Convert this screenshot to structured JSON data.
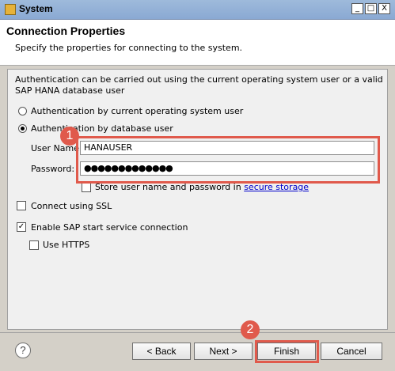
{
  "window": {
    "title": "System",
    "buttons": {
      "minimize": "_",
      "maximize": "□",
      "close": "X"
    }
  },
  "header": {
    "title": "Connection Properties",
    "description": "Specify the properties for connecting to the system."
  },
  "auth": {
    "description": "Authentication can be carried out using the current operating system user or a valid SAP HANA database user",
    "option_os_label": "Authentication by current operating system user",
    "option_db_label": "Authentication by database user",
    "option_os_selected": false,
    "option_db_selected": true
  },
  "credentials": {
    "username_label": "User Name:",
    "username_value": "HANAUSER",
    "password_label": "Password:",
    "password_value": "●●●●●●●●●●●●●",
    "store_label": "Store user name and password in",
    "store_link": "secure storage",
    "store_checked": false
  },
  "options": {
    "ssl_label": "Connect using SSL",
    "ssl_checked": false,
    "sap_start_label": "Enable SAP start service connection",
    "sap_start_checked": true,
    "https_label": "Use HTTPS",
    "https_checked": false
  },
  "callouts": {
    "badge1": "1",
    "badge2": "2"
  },
  "footer": {
    "help": "?",
    "back_label": "< Back",
    "next_label": "Next >",
    "finish_label": "Finish",
    "cancel_label": "Cancel"
  },
  "colors": {
    "accent_callout": "#e05a4c",
    "link": "#0000cc"
  }
}
